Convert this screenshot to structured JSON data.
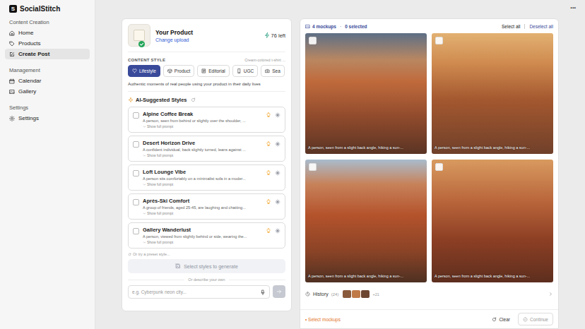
{
  "app": {
    "logo_letter": "S",
    "name": "SocialStitch",
    "menu": "···"
  },
  "sidebar": {
    "sections": [
      {
        "title": "Content Creation",
        "items": [
          {
            "label": "Home",
            "selected": false
          },
          {
            "label": "Products",
            "selected": false
          },
          {
            "label": "Create Post",
            "selected": true
          }
        ]
      },
      {
        "title": "Management",
        "items": [
          {
            "label": "Calendar",
            "selected": false
          },
          {
            "label": "Gallery",
            "selected": false
          }
        ]
      },
      {
        "title": "Settings",
        "items": [
          {
            "label": "Settings",
            "selected": false
          }
        ]
      }
    ]
  },
  "product": {
    "title": "Your Product",
    "link": "Change upload",
    "credits": "76 left",
    "uploaded": true
  },
  "content_style": {
    "label": "CONTENT STYLE",
    "hint": "Cream-colored t-shirt ...",
    "tabs": [
      {
        "label": "Lifestyle",
        "selected": true
      },
      {
        "label": "Product",
        "selected": false
      },
      {
        "label": "Editorial",
        "selected": false
      },
      {
        "label": "UGC",
        "selected": false
      },
      {
        "label": "Sea",
        "selected": false
      }
    ],
    "description": "Authentic moments of real people using your product in their daily lives"
  },
  "suggested": {
    "title": "AI-Suggested Styles",
    "items": [
      {
        "name": "Alpine Coffee Break",
        "prompt": "A person, seen from behind or slightly over the shoulder, ...",
        "toggle": "Show full prompt",
        "checked": false
      },
      {
        "name": "Desert Horizon Drive",
        "prompt": "A confident individual, back slightly turned, leans against ...",
        "toggle": "Show full prompt",
        "checked": false
      },
      {
        "name": "Loft Lounge Vibe",
        "prompt": "A person sits comfortably on a minimalist sofa in a moder...",
        "toggle": "Show full prompt",
        "checked": false
      },
      {
        "name": "Après-Ski Comfort",
        "prompt": "A group of friends, aged 25-45, are laughing and chatting...",
        "toggle": "Show full prompt",
        "checked": false
      },
      {
        "name": "Gallery Wanderlust",
        "prompt": "A person, viewed from slightly behind or side, wearing the...",
        "toggle": "Show full prompt",
        "checked": false
      }
    ],
    "preset": "Or try a preset style...",
    "generate_button": {
      "label": "Select styles to generate",
      "disabled": true
    },
    "divider": "Or describe your own",
    "input": {
      "placeholder": "e.g. Cyberpunk neon city..."
    }
  },
  "mockups": {
    "count": "4 mockups",
    "separator": "·",
    "selected": "0 selected",
    "select_all": "Select all",
    "deselect_all": "Deselect all",
    "items": [
      {
        "caption": "A person, seen from a slight back angle, hiking a sun-...",
        "checked": false
      },
      {
        "caption": "A person, seen from a slight back angle, hiking a sun-...",
        "checked": false
      },
      {
        "caption": "A person, seen from a slight back angle, hiking a sun-...",
        "checked": false
      },
      {
        "caption": "A person, seen from a slight back angle, hiking a sun-...",
        "checked": false
      }
    ]
  },
  "history": {
    "label": "History",
    "count": "(24)",
    "more": "+21"
  },
  "footer": {
    "marker": "•",
    "hint": "Select mockups",
    "clear": "Clear",
    "continue": {
      "label": "Continue",
      "disabled": true
    }
  }
}
